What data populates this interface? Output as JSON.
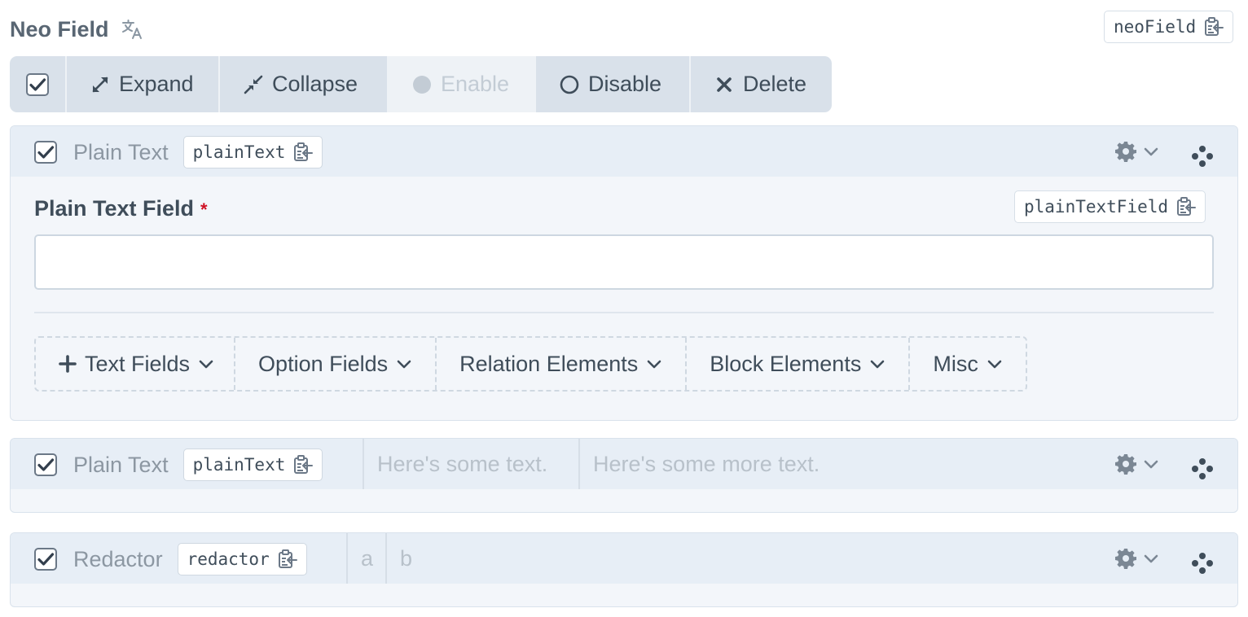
{
  "field": {
    "title": "Neo Field",
    "handle": "neoField",
    "icons": {
      "translate": "translate-icon",
      "copy": "copy-icon"
    }
  },
  "toolbar": {
    "buttons": [
      {
        "label": "Expand",
        "icon": "expand-icon"
      },
      {
        "label": "Collapse",
        "icon": "collapse-icon"
      },
      {
        "label": "Enable",
        "icon": "circle-filled-icon",
        "disabled": true
      },
      {
        "label": "Disable",
        "icon": "circle-outline-icon"
      },
      {
        "label": "Delete",
        "icon": "x-icon"
      }
    ]
  },
  "blocks": [
    {
      "title": "Plain Text",
      "handle": "plainText",
      "checked": true,
      "expanded": true,
      "field": {
        "label": "Plain Text Field",
        "required": "*",
        "handle": "plainTextField",
        "value": ""
      },
      "add_buttons": [
        {
          "label": "Text Fields",
          "has_plus": true
        },
        {
          "label": "Option Fields"
        },
        {
          "label": "Relation Elements"
        },
        {
          "label": "Block Elements"
        },
        {
          "label": "Misc"
        }
      ]
    },
    {
      "title": "Plain Text",
      "handle": "plainText",
      "checked": true,
      "expanded": false,
      "summary": [
        "Here's some text.",
        "Here's some more text."
      ]
    },
    {
      "title": "Redactor",
      "handle": "redactor",
      "checked": true,
      "expanded": false,
      "summary": [
        "a",
        "b"
      ]
    }
  ],
  "colors": {
    "accent_text": "#3f4d5a",
    "toolbar_bg": "#d9e1ea",
    "required": "#cf1124",
    "block_header_bg": "#e7eef6"
  }
}
